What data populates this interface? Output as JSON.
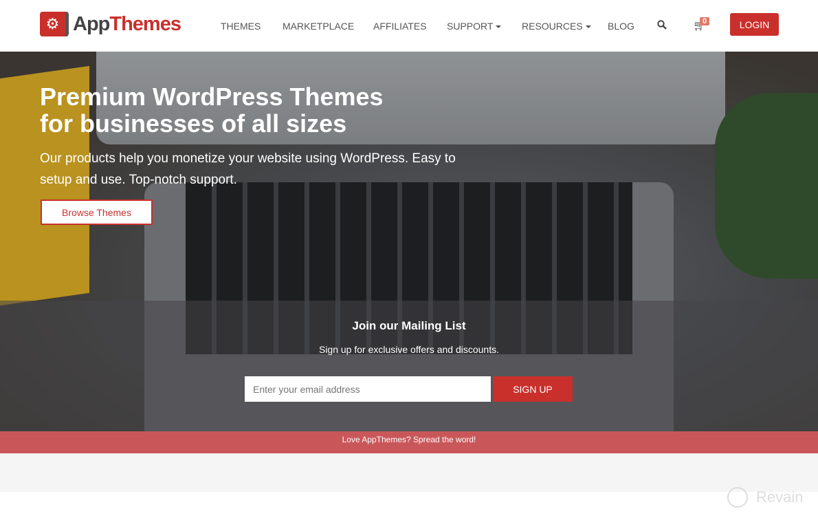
{
  "header": {
    "logo": {
      "part1": "App",
      "part2": "Themes"
    },
    "nav": [
      {
        "label": "THEMES"
      },
      {
        "label": "MARKETPLACE"
      },
      {
        "label": "AFFILIATES"
      },
      {
        "label": "SUPPORT",
        "dropdown": true
      },
      {
        "label": "RESOURCES",
        "dropdown": true
      },
      {
        "label": "BLOG"
      }
    ],
    "cart_count": "0",
    "login_label": "LOGIN",
    "icons": [
      "search-icon",
      "cart-icon"
    ]
  },
  "hero": {
    "title_line1": "Premium WordPress Themes",
    "title_line2": "for businesses of all sizes",
    "subtitle": "Our products help you monetize your website using WordPress. Easy to setup and use. Top-notch support.",
    "browse_label": "Browse Themes"
  },
  "mailing": {
    "title": "Join our Mailing List",
    "subtitle": "Sign up for exclusive offers and discounts.",
    "placeholder": "Enter your email address",
    "button": "SIGN UP"
  },
  "spread": "Love AppThemes? Spread the word!",
  "watermark": "Revain",
  "colors": {
    "brand": "#c9302c",
    "spread_bar": "#c9575a"
  }
}
